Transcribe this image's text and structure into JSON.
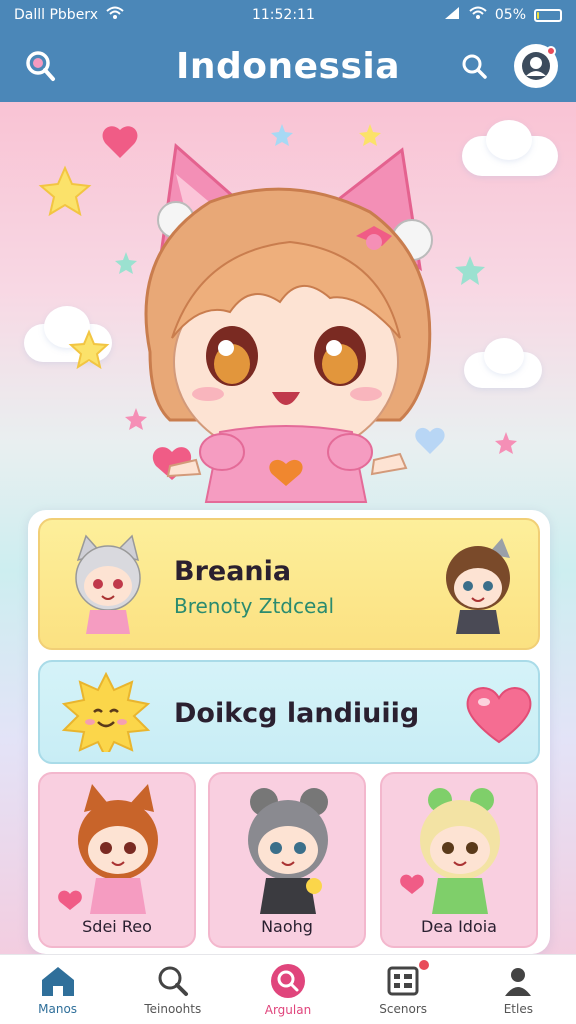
{
  "status_bar": {
    "carrier": "Dalll Pbberx",
    "time": "11:52:11",
    "battery": "05%",
    "battery_level": 0.05,
    "signal_icon": "signal-icon",
    "wifi_icon": "wifi-icon"
  },
  "header": {
    "title": "Indonessia",
    "left_icon": "search-glass-icon",
    "search_icon": "search-icon",
    "profile_icon": "profile-icon",
    "accent": "#4b87b8"
  },
  "banners": [
    {
      "title": "Breania",
      "subtitle": "Brenoty Ztdceal"
    },
    {
      "title": "Doikcg landiuiig",
      "subtitle": ""
    }
  ],
  "tiles": [
    {
      "label": "Sdei Reo"
    },
    {
      "label": "Naohg"
    },
    {
      "label": "Dea Idoia"
    }
  ],
  "nav": {
    "items": [
      {
        "label": "Manos",
        "icon": "home-icon"
      },
      {
        "label": "Teinoohts",
        "icon": "search-icon"
      },
      {
        "label": "Argulan",
        "icon": "search-circle-icon"
      },
      {
        "label": "Scenors",
        "icon": "grid-icon"
      },
      {
        "label": "Etles",
        "icon": "person-icon"
      }
    ]
  },
  "colors": {
    "pink": "#f28bb0",
    "yellow": "#fbe181",
    "blue": "#c8edf5",
    "active": "#e0457c"
  }
}
